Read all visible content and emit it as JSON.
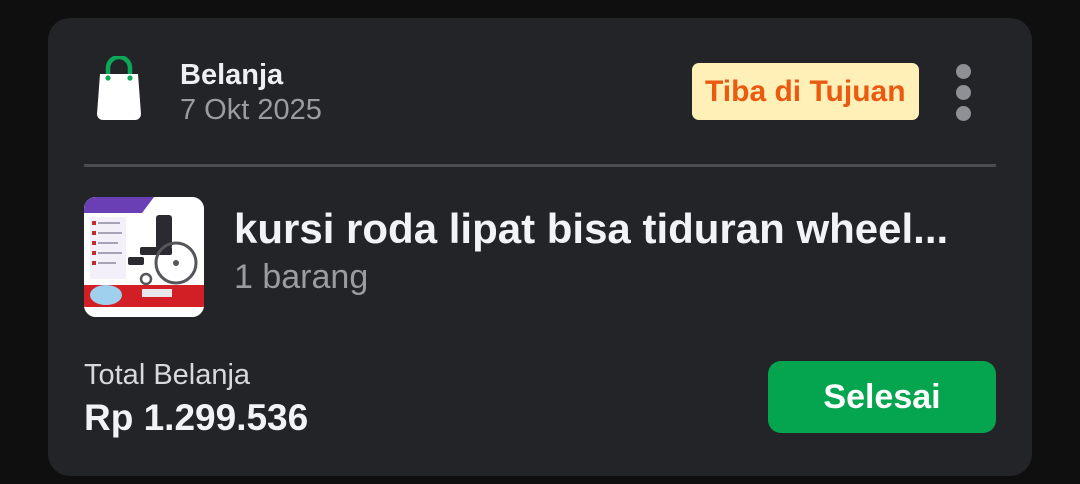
{
  "order": {
    "category": "Belanja",
    "date": "7 Okt 2025",
    "status": "Tiba di Tujuan"
  },
  "product": {
    "name": "kursi roda lipat bisa tiduran wheel...",
    "item_count": "1 barang"
  },
  "total": {
    "label": "Total Belanja",
    "value": "Rp 1.299.536"
  },
  "actions": {
    "done_label": "Selesai"
  },
  "icons": {
    "category": "shopping-bag-icon",
    "menu": "more-vertical-icon"
  },
  "colors": {
    "accent_green": "#05a44f",
    "status_text": "#ea5a11",
    "status_bg": "#fff0b8",
    "card_bg": "#232428"
  }
}
